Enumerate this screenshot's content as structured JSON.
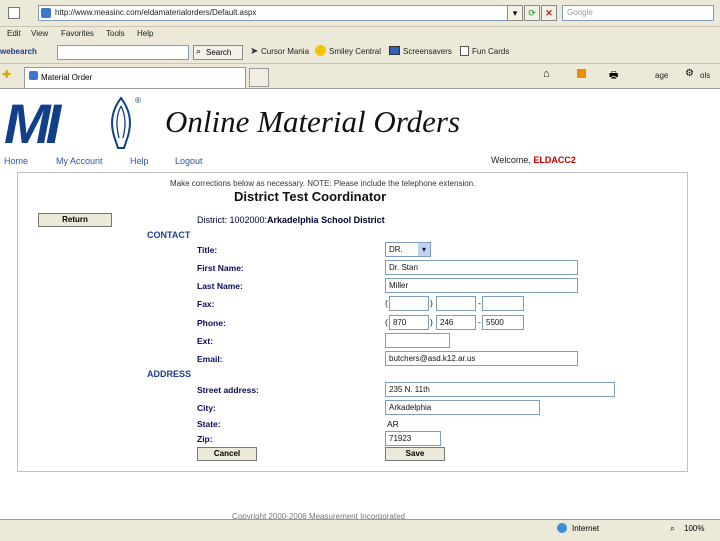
{
  "browser": {
    "address": "http://www.measinc.com/eldamaterialorders/Default.aspx",
    "search_placeholder": "Google",
    "menu": [
      "Edit",
      "View",
      "Favorites",
      "Tools",
      "Help"
    ],
    "toolbar": {
      "brand": "webearch",
      "search_label": "Search",
      "items": [
        "Cursor Mania",
        "Smiley Central",
        "Screensavers",
        "Fun Cards"
      ]
    },
    "tab_title": "Material Order",
    "page_menu": "age",
    "tools_menu": "ols"
  },
  "header": {
    "logo": "MI",
    "title": "Online Material Orders",
    "nav": [
      "Home",
      "My Account",
      "Help",
      "Logout"
    ],
    "welcome_label": "Welcome,",
    "welcome_user": "ELDACC2"
  },
  "form": {
    "note": "Make corrections below as necessary. NOTE: Please include the telephone extension.",
    "title": "District Test Coordinator",
    "return_label": "Return",
    "district_label": "District: 1002000:",
    "district_name": "Arkadelphia School District",
    "contact_heading": "CONTACT",
    "address_heading": "ADDRESS",
    "labels": {
      "title": "Title:",
      "first_name": "First Name:",
      "last_name": "Last Name:",
      "fax": "Fax:",
      "phone": "Phone:",
      "ext": "Ext:",
      "email": "Email:",
      "street": "Street address:",
      "city": "City:",
      "state": "State:",
      "zip": "Zip:"
    },
    "values": {
      "title": "DR.",
      "first_name": "Dr. Stan",
      "last_name": "Miller",
      "fax": [
        "",
        "",
        ""
      ],
      "phone": [
        "870",
        "246",
        "5500"
      ],
      "ext": "",
      "email": "butchers@asd.k12.ar.us",
      "street": "235 N. 11th",
      "city": "Arkadelphia",
      "state": "AR",
      "zip": "71923"
    },
    "cancel_label": "Cancel",
    "save_label": "Save"
  },
  "footer": "Copyright 2000-2006 Measurement Incorporated",
  "status": {
    "zone": "Internet",
    "zoom": "100%"
  }
}
